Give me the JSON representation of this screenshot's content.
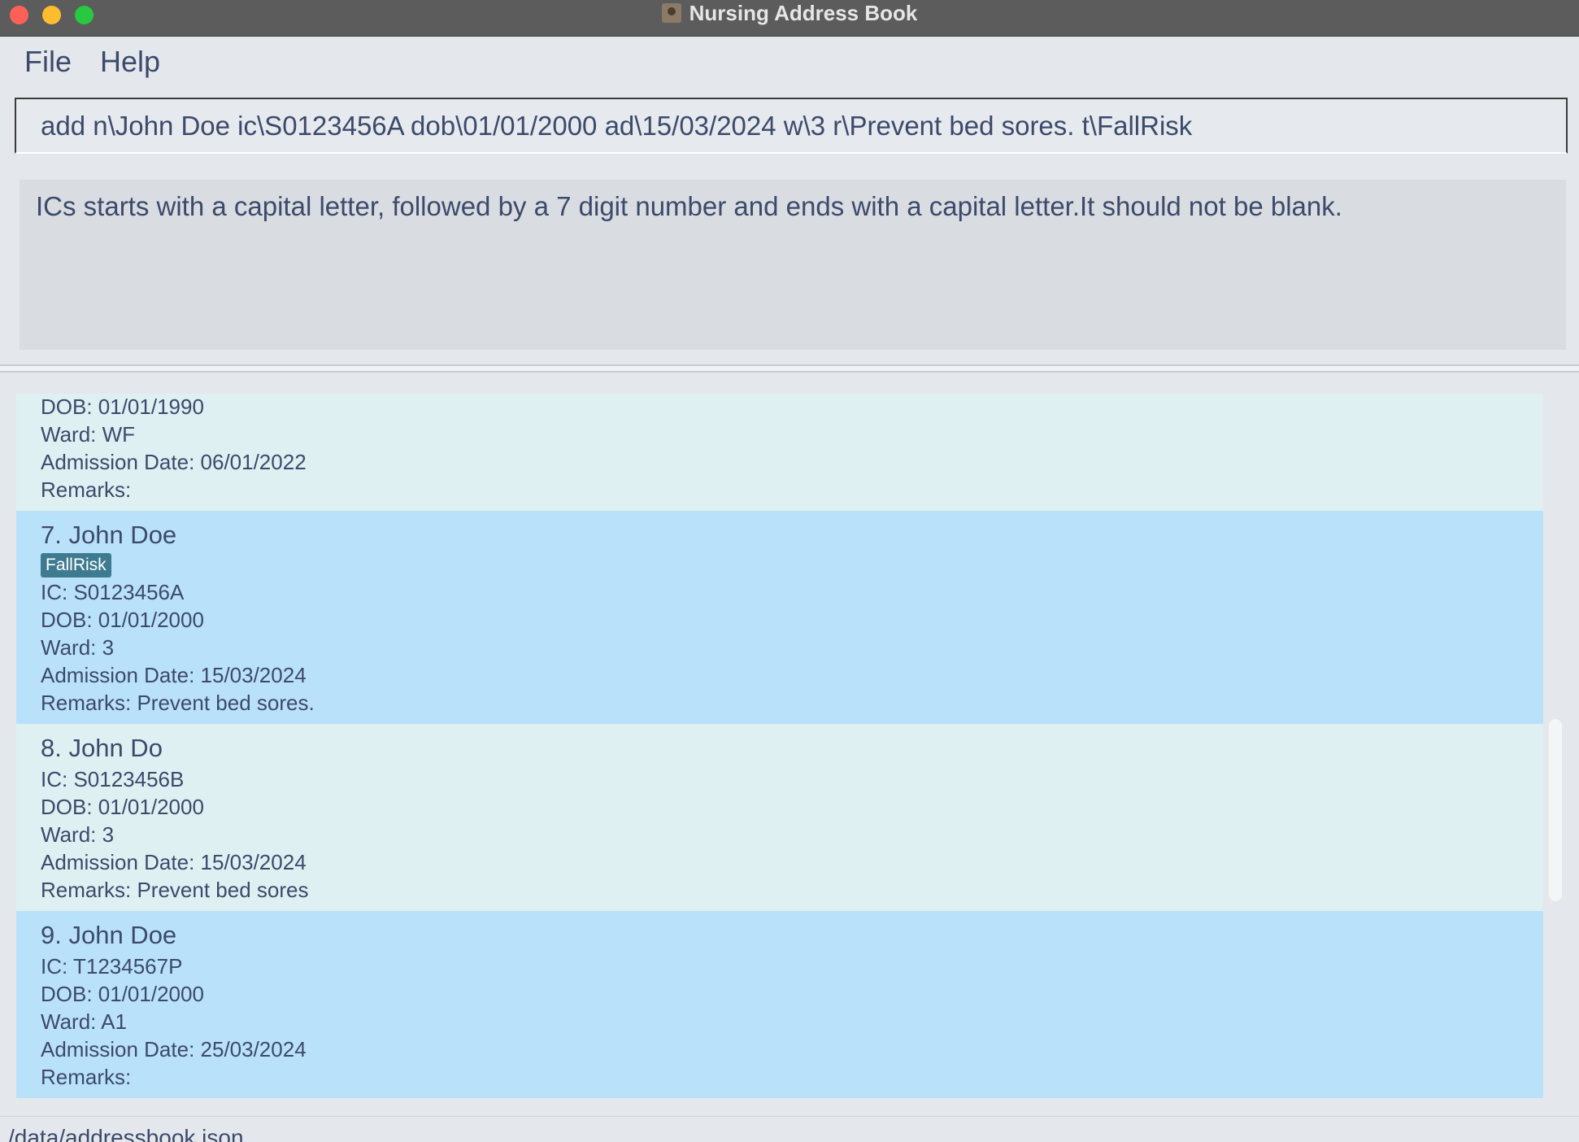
{
  "window": {
    "title": "Nursing Address Book"
  },
  "menu": {
    "file": "File",
    "help": "Help"
  },
  "command": {
    "value": "add n\\John Doe ic\\S0123456A dob\\01/01/2000 ad\\15/03/2024 w\\3 r\\Prevent bed sores. t\\FallRisk"
  },
  "result": {
    "message": "ICs starts with a capital letter, followed by a 7 digit number and ends with a capital letter.It should not be blank."
  },
  "patients": [
    {
      "dob": "DOB: 01/01/1990",
      "ward": "Ward: WF",
      "admission": "Admission Date: 06/01/2022",
      "remarks": "Remarks:"
    },
    {
      "name": "7.  John Doe",
      "tag": "FallRisk",
      "ic": "IC: S0123456A",
      "dob": "DOB: 01/01/2000",
      "ward": "Ward: 3",
      "admission": "Admission Date: 15/03/2024",
      "remarks": "Remarks: Prevent bed sores."
    },
    {
      "name": "8.  John Do",
      "ic": "IC: S0123456B",
      "dob": "DOB: 01/01/2000",
      "ward": "Ward: 3",
      "admission": "Admission Date: 15/03/2024",
      "remarks": "Remarks: Prevent bed sores"
    },
    {
      "name": "9.  John Doe",
      "ic": "IC: T1234567P",
      "dob": "DOB: 01/01/2000",
      "ward": "Ward: A1",
      "admission": "Admission Date: 25/03/2024",
      "remarks": "Remarks:"
    }
  ],
  "status": {
    "path": "/data/addressbook.json"
  },
  "colors": {
    "card_light": "#dff0f3",
    "card_selected": "#b9e1fa",
    "tag": "#3e7b91",
    "text": "#3c4a6b"
  }
}
